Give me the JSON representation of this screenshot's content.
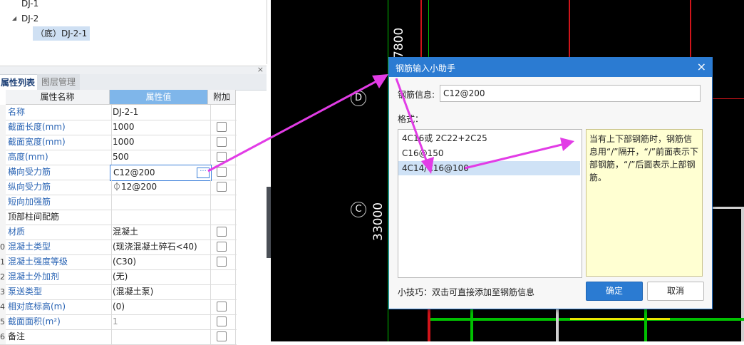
{
  "tree": {
    "items": [
      "DJ-1",
      "DJ-2",
      "（底）DJ-2-1"
    ]
  },
  "panel": {
    "close": "×",
    "tabs": [
      "属性列表",
      "图层管理"
    ]
  },
  "table": {
    "headers": [
      "属性名称",
      "属性值",
      "附加"
    ],
    "rows": [
      {
        "num": "",
        "name": "名称",
        "value": "DJ-2-1",
        "blue": true
      },
      {
        "num": "",
        "name": "截面长度(mm)",
        "value": "1000",
        "blue": true
      },
      {
        "num": "",
        "name": "截面宽度(mm)",
        "value": "1000",
        "blue": true
      },
      {
        "num": "",
        "name": "高度(mm)",
        "value": "500",
        "blue": true
      },
      {
        "num": "",
        "name": "横向受力筋",
        "value": "C12@200",
        "blue": true
      },
      {
        "num": "",
        "name": "纵向受力筋",
        "value": "⏀12@200",
        "blue": true
      },
      {
        "num": "",
        "name": "短向加强筋",
        "value": "",
        "blue": true
      },
      {
        "num": "",
        "name": "顶部柱间配筋",
        "value": "",
        "blue": false
      },
      {
        "num": "",
        "name": "材质",
        "value": "混凝土",
        "blue": true
      },
      {
        "num": "0",
        "name": "混凝土类型",
        "value": "(现浇混凝土碎石<40)",
        "blue": true
      },
      {
        "num": "1",
        "name": "混凝土强度等级",
        "value": "(C30)",
        "blue": true
      },
      {
        "num": "2",
        "name": "混凝土外加剂",
        "value": "(无)",
        "blue": true
      },
      {
        "num": "3",
        "name": "泵送类型",
        "value": "(混凝土泵)",
        "blue": true
      },
      {
        "num": "4",
        "name": "相对底标高(m)",
        "value": "(0)",
        "blue": true
      },
      {
        "num": "5",
        "name": "截面面积(m²)",
        "value": "1",
        "blue": true
      },
      {
        "num": "6",
        "name": "备注",
        "value": "",
        "blue": false
      }
    ],
    "ellipsis": "···"
  },
  "cad": {
    "axis_d": "D",
    "axis_c": "C",
    "dim_top": "7800",
    "dim_mid": "33000"
  },
  "dialog": {
    "title": "钢筋输入小助手",
    "close": "×",
    "info_label": "钢筋信息:",
    "info_value": "C12@200",
    "format_label": "格式：",
    "formats": [
      "4C16或 2C22+2C25",
      "C16@150",
      "4C14/C16@100"
    ],
    "description": "当有上下部钢筋时，钢筋信息用“/”隔开，“/”前面表示下部钢筋，“/”后面表示上部钢筋。",
    "tip": "小技巧：双击可直接添加至钢筋信息",
    "ok": "确定",
    "cancel": "取消"
  }
}
